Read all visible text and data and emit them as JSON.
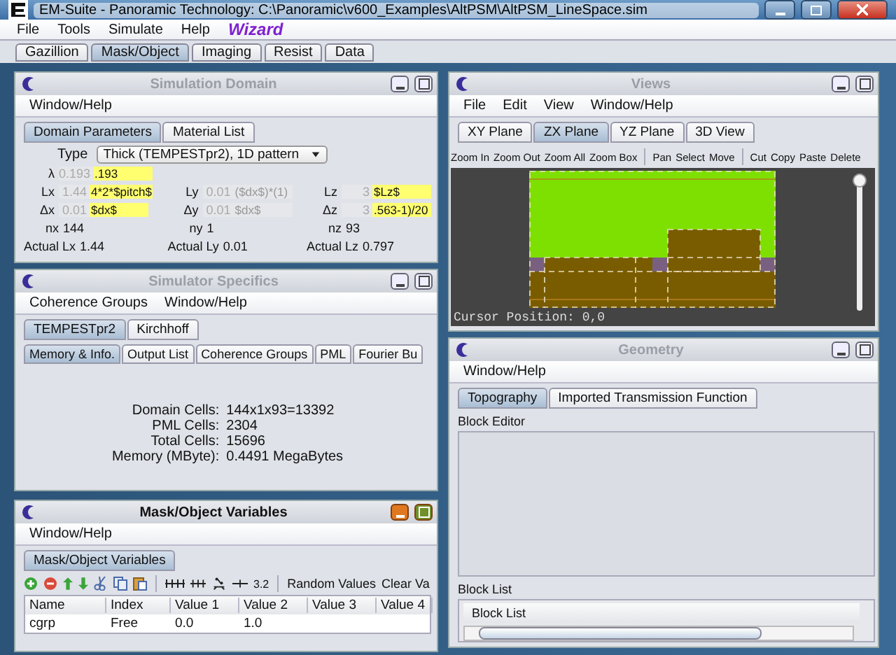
{
  "window": {
    "title": "EM-Suite - Panoramic Technology: C:\\Panoramic\\v600_Examples\\AltPSM\\AltPSM_LineSpace.sim"
  },
  "menu": [
    "File",
    "Tools",
    "Simulate",
    "Help"
  ],
  "wizard": "Wizard",
  "tabs": [
    {
      "label": "Gazillion",
      "selected": false
    },
    {
      "label": "Mask/Object",
      "selected": true
    },
    {
      "label": "Imaging",
      "selected": false
    },
    {
      "label": "Resist",
      "selected": false
    },
    {
      "label": "Data",
      "selected": false
    }
  ],
  "simulation_domain": {
    "title": "Simulation Domain",
    "active": false,
    "menu": [
      "Window/Help"
    ],
    "tabs": [
      {
        "label": "Domain Parameters",
        "selected": true
      },
      {
        "label": "Material List",
        "selected": false
      }
    ],
    "type_label": "Type",
    "type_value": "Thick (TEMPESTpr2), 1D pattern",
    "rows": [
      [
        {
          "kind": "field",
          "label": "λ",
          "computed": "0.193",
          "expression": ".193",
          "editable": true
        }
      ],
      [
        {
          "kind": "field",
          "label": "Lx",
          "computed": "1.44",
          "expression": "4*2*$pitch$",
          "editable": true
        },
        {
          "kind": "field",
          "label": "Ly",
          "computed": "0.01",
          "expression": "($dx$)*(1)",
          "editable": false
        },
        {
          "kind": "field",
          "label": "Lz",
          "computed": "3",
          "expression": "$Lz$",
          "editable": true
        }
      ],
      [
        {
          "kind": "field",
          "label": "Δx",
          "computed": "0.01",
          "expression": "$dx$",
          "editable": true
        },
        {
          "kind": "field",
          "label": "Δy",
          "computed": "0.01",
          "expression": "$dx$",
          "editable": false
        },
        {
          "kind": "field",
          "label": "Δz",
          "computed": "3",
          "expression": ".563-1)/20",
          "editable": true
        }
      ],
      [
        {
          "kind": "info",
          "label": "nx",
          "value": "144"
        },
        {
          "kind": "info",
          "label": "ny",
          "value": "1"
        },
        {
          "kind": "info",
          "label": "nz",
          "value": "93"
        }
      ],
      [
        {
          "kind": "info",
          "label": "Actual Lx",
          "value": "1.44"
        },
        {
          "kind": "info",
          "label": "Actual Ly",
          "value": "0.01"
        },
        {
          "kind": "info",
          "label": "Actual Lz",
          "value": "0.797"
        }
      ]
    ]
  },
  "simulator_specifics": {
    "title": "Simulator Specifics",
    "active": false,
    "menu": [
      "Coherence Groups",
      "Window/Help"
    ],
    "tabs": [
      {
        "label": "TEMPESTpr2",
        "selected": true
      },
      {
        "label": "Kirchhoff",
        "selected": false
      }
    ],
    "subtabs": [
      {
        "label": "Memory & Info.",
        "selected": true
      },
      {
        "label": "Output List",
        "selected": false
      },
      {
        "label": "Coherence Groups",
        "selected": false
      },
      {
        "label": "PML",
        "selected": false
      },
      {
        "label": "Fourier Bu",
        "selected": false
      }
    ],
    "info": [
      {
        "label": "Domain Cells:",
        "value": "144x1x93=13392"
      },
      {
        "label": "PML Cells:",
        "value": "2304"
      },
      {
        "label": "Total Cells:",
        "value": "15696"
      },
      {
        "label": "Memory (MByte):",
        "value": "0.4491 MegaBytes"
      }
    ]
  },
  "mask_variables": {
    "title": "Mask/Object Variables",
    "active": true,
    "menu": [
      "Window/Help"
    ],
    "tabs": [
      {
        "label": "Mask/Object Variables",
        "selected": true
      }
    ],
    "toolbar_number": "3.2",
    "buttons": [
      "Random Values",
      "Clear Va"
    ],
    "columns": [
      "Name",
      "Index",
      "Value 1",
      "Value 2",
      "Value 3",
      "Value 4"
    ],
    "rows": [
      [
        "cgrp",
        "Free",
        "0.0",
        "1.0",
        "",
        ""
      ]
    ]
  },
  "views": {
    "title": "Views",
    "active": false,
    "menu": [
      "File",
      "Edit",
      "View",
      "Window/Help"
    ],
    "tabs": [
      {
        "label": "XY Plane",
        "selected": false
      },
      {
        "label": "ZX Plane",
        "selected": true
      },
      {
        "label": "YZ Plane",
        "selected": false
      },
      {
        "label": "3D View",
        "selected": false
      }
    ],
    "toolbar": [
      [
        "Zoom In",
        "Zoom Out",
        "Zoom All",
        "Zoom Box"
      ],
      [
        "Pan",
        "Select",
        "Move"
      ],
      [
        "Cut",
        "Copy",
        "Paste",
        "Delete"
      ]
    ],
    "cursor": "Cursor Position: 0,0",
    "slider": {
      "level": 1
    }
  },
  "geometry": {
    "title": "Geometry",
    "active": false,
    "menu": [
      "Window/Help"
    ],
    "tabs": [
      {
        "label": "Topography",
        "selected": true
      },
      {
        "label": "Imported Transmission Function",
        "selected": false
      }
    ],
    "block_editor_label": "Block Editor",
    "block_list_label": "Block List",
    "block_list_header": "Block List"
  }
}
